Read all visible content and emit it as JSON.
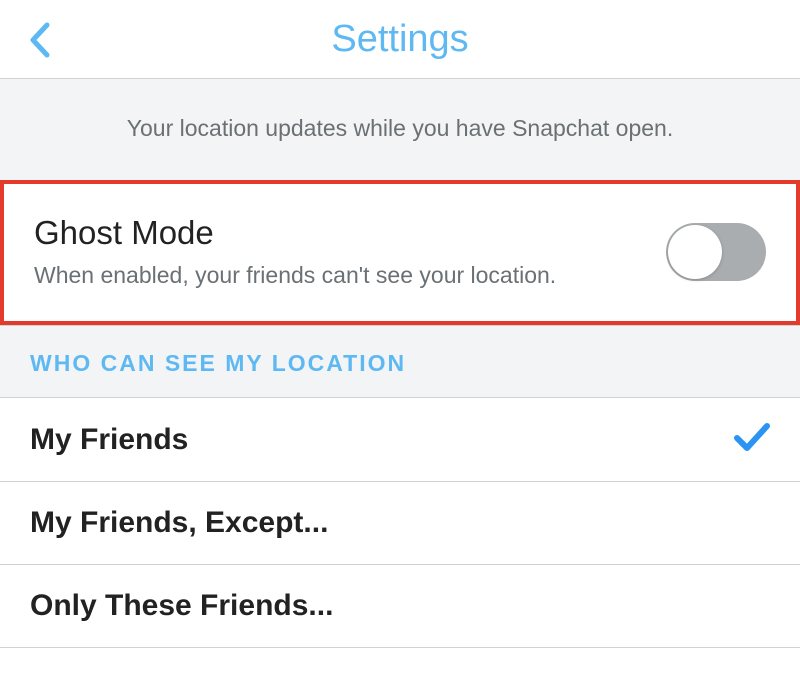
{
  "header": {
    "title": "Settings"
  },
  "info": {
    "text": "Your location updates while you have Snapchat open."
  },
  "ghost": {
    "title": "Ghost Mode",
    "desc": "When enabled, your friends can't see your location.",
    "enabled": false
  },
  "section": {
    "header": "WHO CAN SEE MY LOCATION",
    "options": [
      {
        "label": "My Friends",
        "selected": true
      },
      {
        "label": "My Friends, Except...",
        "selected": false
      },
      {
        "label": "Only These Friends...",
        "selected": false
      }
    ]
  }
}
